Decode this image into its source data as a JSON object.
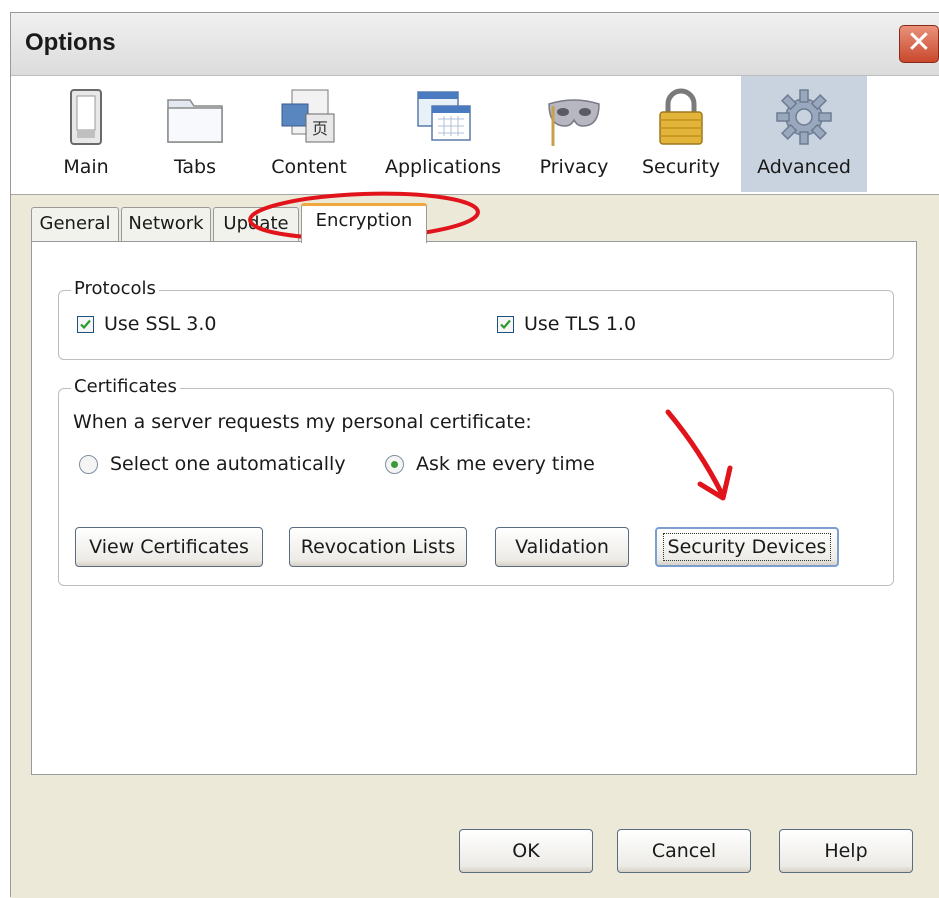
{
  "window": {
    "title": "Options",
    "close_glyph": "✕"
  },
  "toolbar": {
    "panes": [
      {
        "label": "Main",
        "icon": "switch-icon"
      },
      {
        "label": "Tabs",
        "icon": "tabs-icon"
      },
      {
        "label": "Content",
        "icon": "content-icon"
      },
      {
        "label": "Applications",
        "icon": "applications-icon"
      },
      {
        "label": "Privacy",
        "icon": "mask-icon"
      },
      {
        "label": "Security",
        "icon": "padlock-icon"
      },
      {
        "label": "Advanced",
        "icon": "gear-icon"
      }
    ],
    "selected": "Advanced"
  },
  "tabs": {
    "items": [
      "General",
      "Network",
      "Update",
      "Encryption"
    ],
    "selected": "Encryption"
  },
  "protocols": {
    "legend": "Protocols",
    "ssl_label": "Use SSL 3.0",
    "ssl_checked": true,
    "tls_label": "Use TLS 1.0",
    "tls_checked": true
  },
  "certificates": {
    "legend": "Certificates",
    "prompt": "When a server requests my personal certificate:",
    "radio_auto": "Select one automatically",
    "radio_ask": "Ask me every time",
    "selected_radio": "Ask me every time",
    "buttons": {
      "view": "View Certificates",
      "revocation": "Revocation Lists",
      "validation": "Validation",
      "devices": "Security Devices"
    }
  },
  "footer": {
    "ok": "OK",
    "cancel": "Cancel",
    "help": "Help"
  },
  "annotations": {
    "highlight_color": "#e0141a"
  },
  "colors": {
    "selected_pane": "#c9d3e0",
    "tab_accent": "#f0a83c",
    "checkbox_mark": "#2a9a2a"
  }
}
